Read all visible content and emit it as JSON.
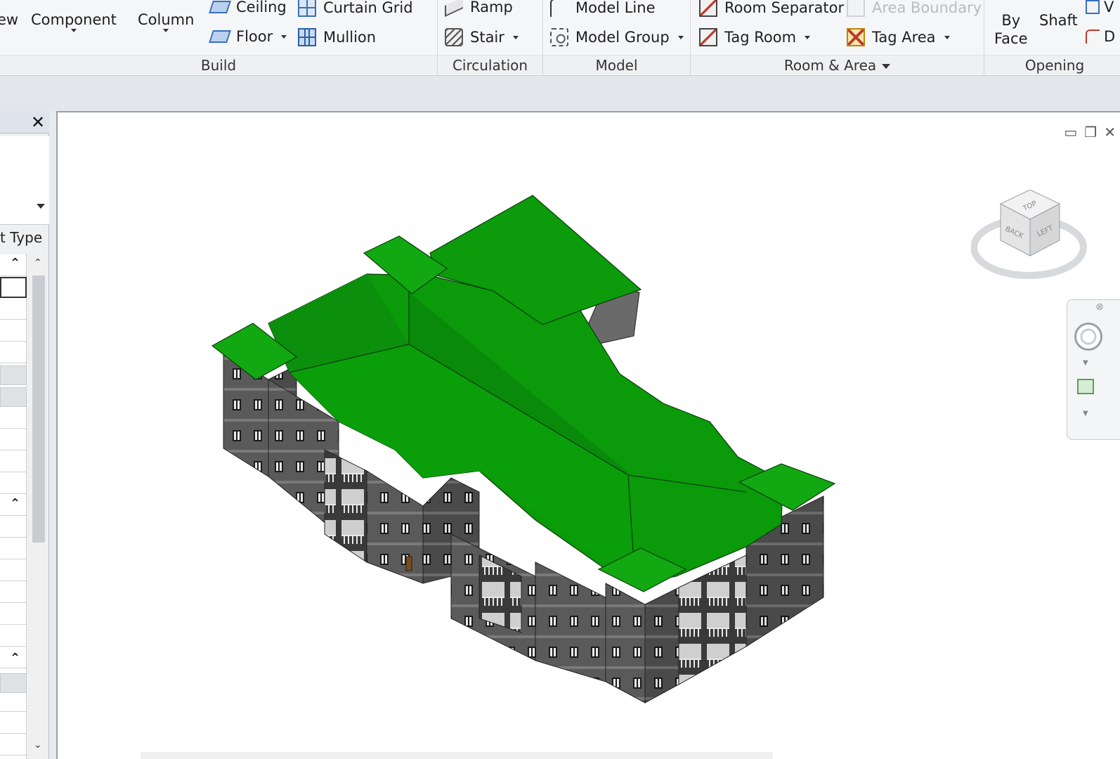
{
  "ribbon": {
    "cut_left_labels": {
      "view": "ew"
    },
    "build": {
      "title": "Build",
      "component": "Component",
      "column": "Column",
      "ceiling": "Ceiling",
      "floor": "Floor",
      "curtain_grid": "Curtain Grid",
      "mullion": "Mullion"
    },
    "circulation": {
      "title": "Circulation",
      "ramp": "Ramp",
      "stair": "Stair"
    },
    "model": {
      "title": "Model",
      "model_line": "Model Line",
      "model_group": "Model Group"
    },
    "room_area": {
      "title": "Room & Area",
      "room_separator": "Room Separator",
      "area_boundary": "Area Boundary",
      "tag_room": "Tag Room",
      "tag_area": "Tag Area"
    },
    "opening": {
      "title": "Opening",
      "by_face_1": "By",
      "by_face_2": "Face",
      "shaft": "Shaft",
      "cut_1": "V",
      "cut_2": "D"
    }
  },
  "properties": {
    "edit_type_label": "t Type",
    "close_glyph": "✕"
  },
  "viewport": {
    "window_controls": [
      "▭",
      "❐",
      "✕"
    ],
    "viewcube_faces": {
      "top": "TOP",
      "back": "BACK",
      "left": "LEFT"
    },
    "roof_color": "#0a9a0a",
    "wall_color": "#5a5a5a"
  }
}
